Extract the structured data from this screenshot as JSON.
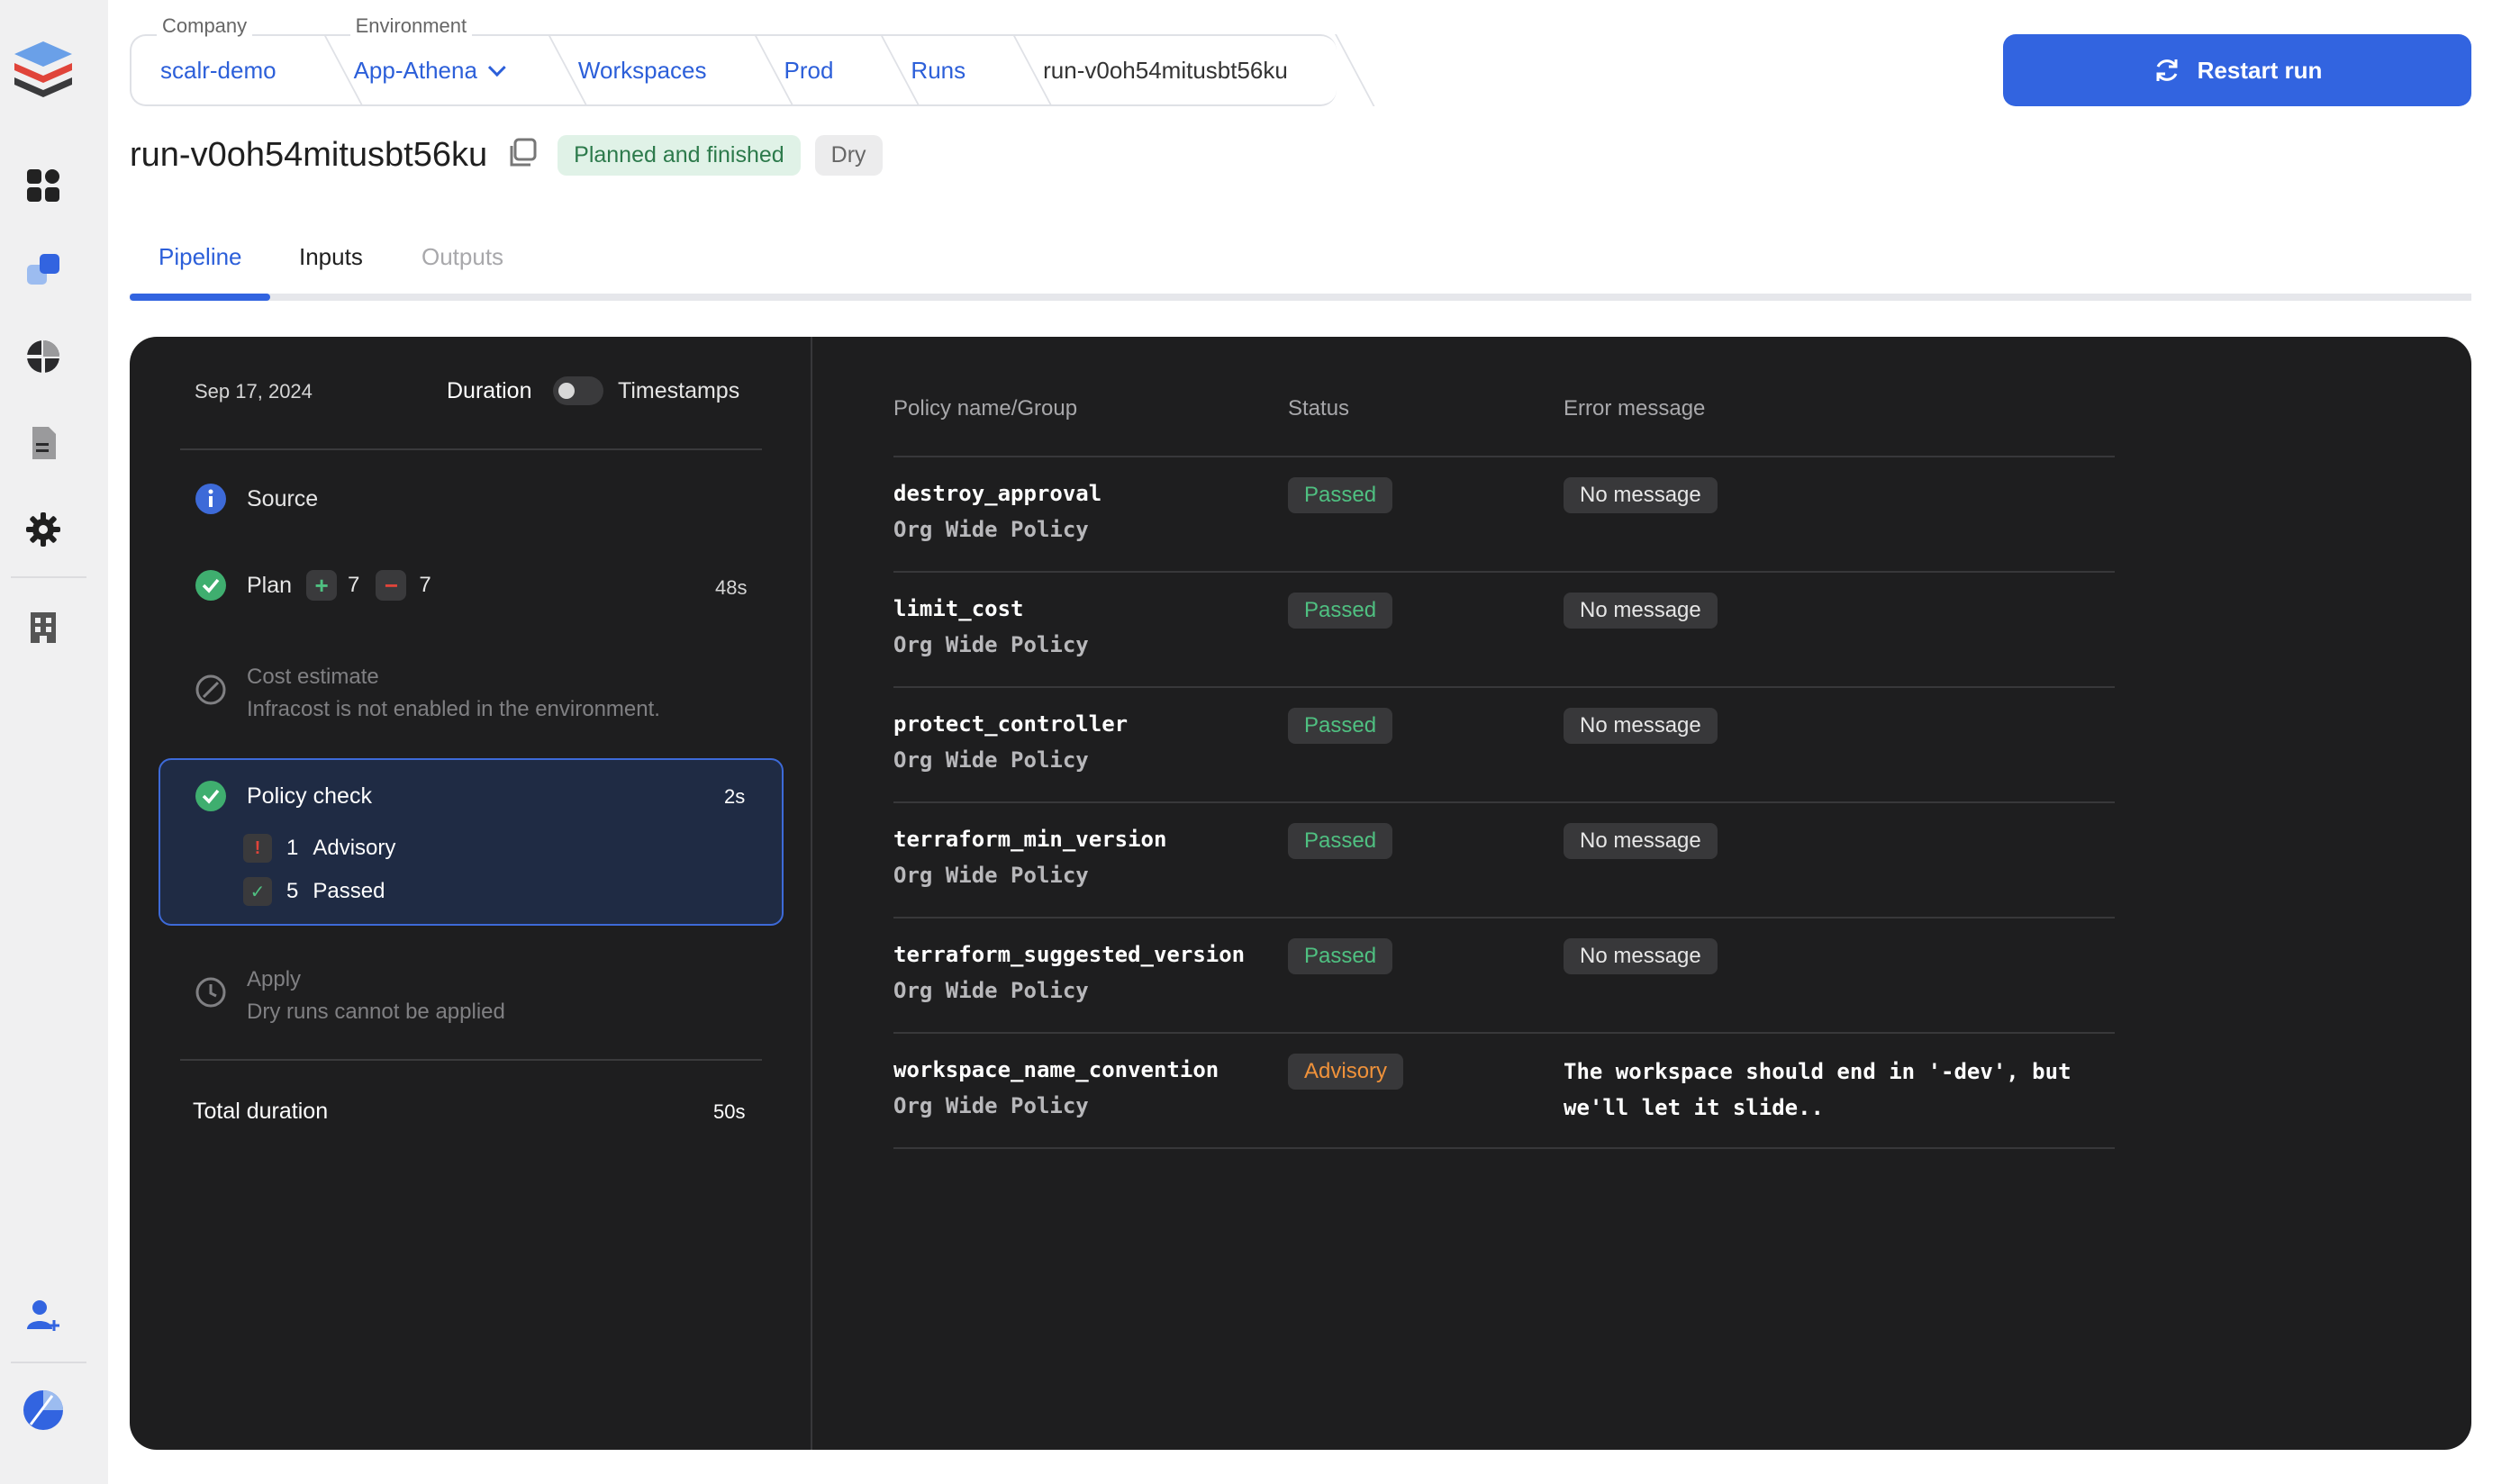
{
  "breadcrumb": {
    "company_caption": "Company",
    "company": "scalr-demo",
    "environment_caption": "Environment",
    "environment": "App-Athena",
    "workspaces": "Workspaces",
    "workspace": "Prod",
    "runs": "Runs",
    "run": "run-v0oh54mitusbt56ku"
  },
  "actions": {
    "restart": "Restart run"
  },
  "header": {
    "title": "run-v0oh54mitusbt56ku",
    "status_badge": "Planned and finished",
    "type_badge": "Dry"
  },
  "tabs": [
    {
      "label": "Pipeline",
      "active": true
    },
    {
      "label": "Inputs",
      "active": false
    },
    {
      "label": "Outputs",
      "active": false,
      "disabled": true
    }
  ],
  "pipeline": {
    "date": "Sep 17, 2024",
    "duration_label": "Duration",
    "timestamps_label": "Timestamps",
    "source": {
      "label": "Source"
    },
    "plan": {
      "label": "Plan",
      "add": "7",
      "remove": "7",
      "time": "48s"
    },
    "cost": {
      "label": "Cost estimate",
      "sub": "Infracost is not enabled in the environment."
    },
    "policy": {
      "label": "Policy check",
      "time": "2s",
      "advisory_count": "1",
      "advisory_label": "Advisory",
      "passed_count": "5",
      "passed_label": "Passed"
    },
    "apply": {
      "label": "Apply",
      "sub": "Dry runs cannot be applied"
    },
    "total_label": "Total duration",
    "total_time": "50s"
  },
  "policy_table": {
    "headers": [
      "Policy name/Group",
      "Status",
      "Error message"
    ],
    "rows": [
      {
        "name": "destroy_approval",
        "group": "Org Wide Policy",
        "status": "Passed",
        "message": "No message"
      },
      {
        "name": "limit_cost",
        "group": "Org Wide Policy",
        "status": "Passed",
        "message": "No message"
      },
      {
        "name": "protect_controller",
        "group": "Org Wide Policy",
        "status": "Passed",
        "message": "No message"
      },
      {
        "name": "terraform_min_version",
        "group": "Org Wide Policy",
        "status": "Passed",
        "message": "No message"
      },
      {
        "name": "terraform_suggested_version",
        "group": "Org Wide Policy",
        "status": "Passed",
        "message": "No message"
      },
      {
        "name": "workspace_name_convention",
        "group": "Org Wide Policy",
        "status": "Advisory",
        "message_line1": "The workspace should end in '-dev', but",
        "message_line2": "we'll let it slide.."
      }
    ]
  },
  "colors": {
    "accent": "#3264e0",
    "panel": "#1e1e1f",
    "passed": "#4fc081",
    "advisory": "#f0923a"
  },
  "icons": [
    "app-logo-icon",
    "dashboard-icon",
    "workspaces-icon",
    "reports-icon",
    "documents-icon",
    "settings-icon",
    "organization-icon",
    "add-user-icon",
    "account-avatar-icon"
  ]
}
